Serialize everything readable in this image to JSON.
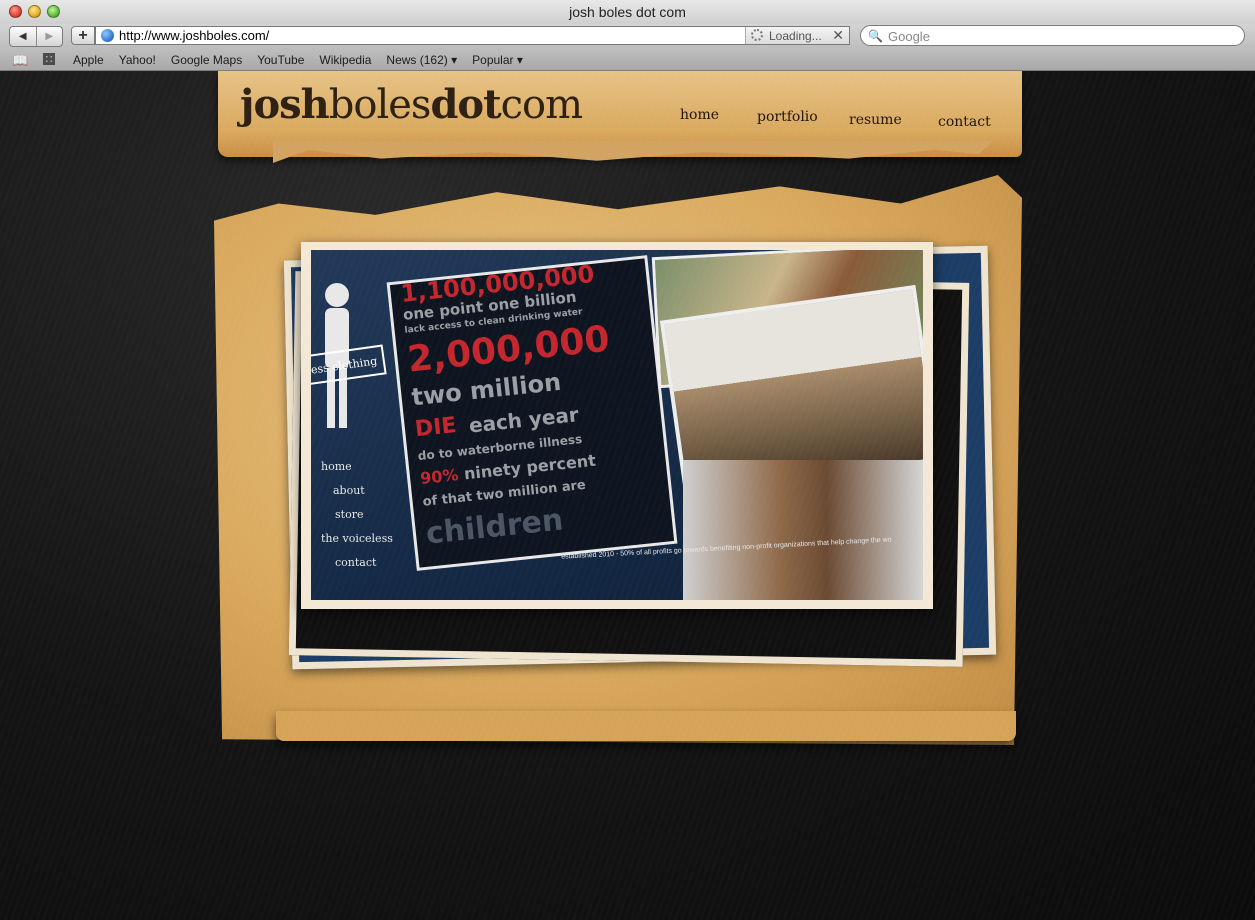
{
  "browser": {
    "window_title": "josh boles dot com",
    "nav_back": "◀",
    "nav_forward": "▶",
    "add_label": "+",
    "url": "http://www.joshboles.com/",
    "loading_label": "Loading...",
    "stop_label": "✕",
    "search_placeholder": "Google",
    "bookmarks": [
      "Apple",
      "Yahoo!",
      "Google Maps",
      "YouTube",
      "Wikipedia",
      "News (162) ▾",
      "Popular ▾"
    ]
  },
  "site": {
    "logo": {
      "part1": "josh",
      "part2": "boles",
      "part3": "dot",
      "part4": "com"
    },
    "nav": [
      "home",
      "portfolio",
      "resume",
      "contact"
    ],
    "showcase": {
      "sign_text": "ess clothing",
      "side_nav": [
        "home",
        "about",
        "store",
        "the voiceless",
        "contact"
      ],
      "poster_lines": [
        "1,100,000,000",
        "one point one billion",
        "lack access to clean drinking water",
        "2,000,000",
        "two million",
        "DIE",
        "each year",
        "do to waterborne illness",
        "90%",
        "ninety percent",
        "of that two million are",
        "children"
      ],
      "footer": "established 2010 - 50% of all profits go towards benefiting non-profit organizations that help change the wo"
    }
  }
}
